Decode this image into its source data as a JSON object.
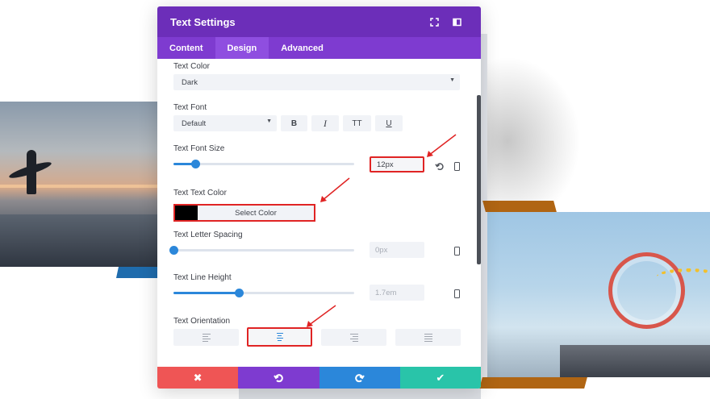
{
  "modal": {
    "title": "Text Settings",
    "tabs": [
      {
        "label": "Content"
      },
      {
        "label": "Design"
      },
      {
        "label": "Advanced"
      }
    ],
    "active_tab": "Design"
  },
  "fields": {
    "text_color": {
      "label": "Text Color",
      "value": "Dark"
    },
    "text_font": {
      "label": "Text Font",
      "value": "Default",
      "style_buttons": [
        {
          "label": "B"
        },
        {
          "label": "I"
        },
        {
          "label": "TT"
        },
        {
          "label": "U"
        }
      ]
    },
    "text_font_size": {
      "label": "Text Font Size",
      "value": "12px",
      "slider_fraction": 0.12
    },
    "text_text_color": {
      "label": "Text Text Color",
      "button_label": "Select Color",
      "swatch_color": "#000000"
    },
    "text_letter_spacing": {
      "label": "Text Letter Spacing",
      "placeholder": "0px",
      "slider_fraction": 0.0
    },
    "text_line_height": {
      "label": "Text Line Height",
      "placeholder": "1.7em",
      "slider_fraction": 0.36
    },
    "text_orientation": {
      "label": "Text Orientation",
      "options": [
        "left",
        "center",
        "right",
        "justify"
      ],
      "selected": "center"
    }
  },
  "actions": {
    "cancel_icon": "close-icon",
    "undo_icon": "undo-icon",
    "redo_icon": "redo-icon",
    "save_icon": "check-icon"
  },
  "colors": {
    "header": "#6c2eb9",
    "tabs": "#7e3bd0",
    "accent_blue": "#2b87da",
    "highlight_red": "#e02424",
    "cancel": "#ef5555",
    "save": "#29c4a9"
  }
}
